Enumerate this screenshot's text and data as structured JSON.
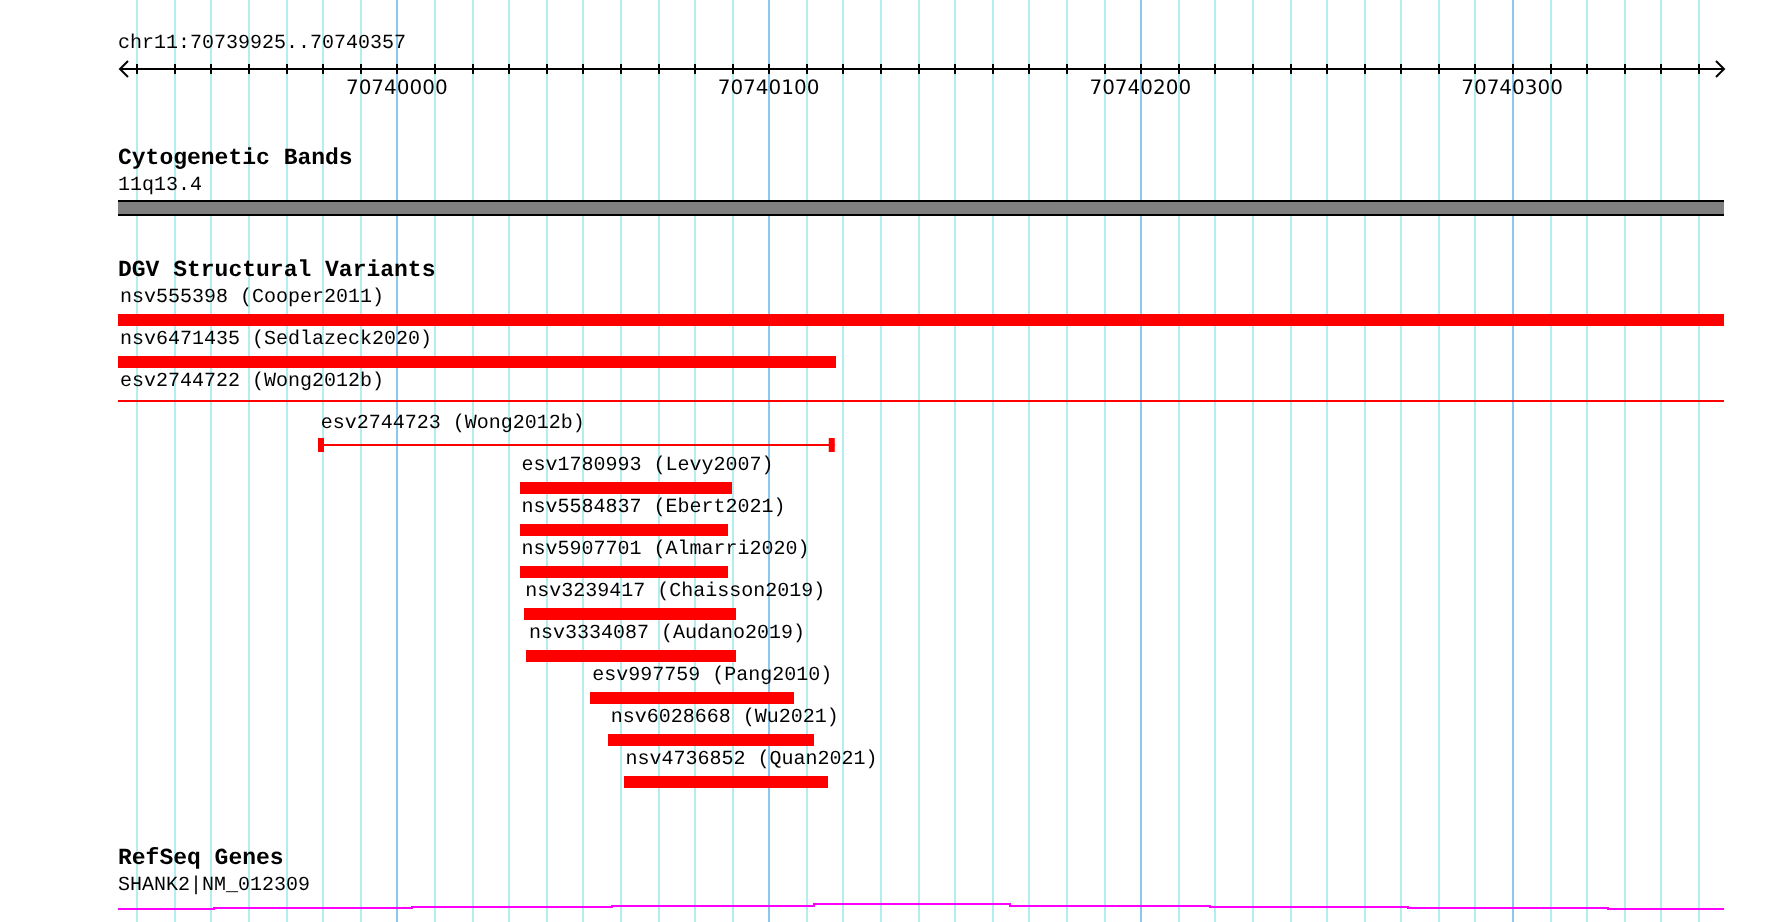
{
  "ruler": {
    "label": "chr11:70739925..70740357",
    "xticks": [
      "70740000",
      "70740100",
      "70740200",
      "70740300"
    ]
  },
  "tracks": [
    {
      "kind": "bands",
      "title": "Cytogenetic Bands",
      "label": "11q13.4"
    },
    {
      "kind": "variants",
      "title": "DGV Structural Variants",
      "features": [
        {
          "name": "nsv555398 (Cooper2011)",
          "kind": "bar"
        },
        {
          "name": "nsv6471435 (Sedlazeck2020)",
          "kind": "bar"
        },
        {
          "name": "esv2744722 (Wong2012b)",
          "kind": "line"
        },
        {
          "name": "esv2744723 (Wong2012b)",
          "kind": "line"
        },
        {
          "name": "esv1780993 (Levy2007)",
          "kind": "bar"
        },
        {
          "name": "nsv5584837 (Ebert2021)",
          "kind": "bar"
        },
        {
          "name": "nsv5907701 (Almarri2020)",
          "kind": "bar"
        },
        {
          "name": "nsv3239417 (Chaisson2019)",
          "kind": "bar"
        },
        {
          "name": "nsv3334087 (Audano2019)",
          "kind": "bar"
        },
        {
          "name": "esv997759 (Pang2010)",
          "kind": "bar"
        },
        {
          "name": "nsv6028668 (Wu2021)",
          "kind": "bar"
        },
        {
          "name": "nsv4736852 (Quan2021)",
          "kind": "bar"
        }
      ]
    },
    {
      "kind": "genes",
      "title": "RefSeq Genes",
      "label": "SHANK2|NM_012309"
    }
  ]
}
